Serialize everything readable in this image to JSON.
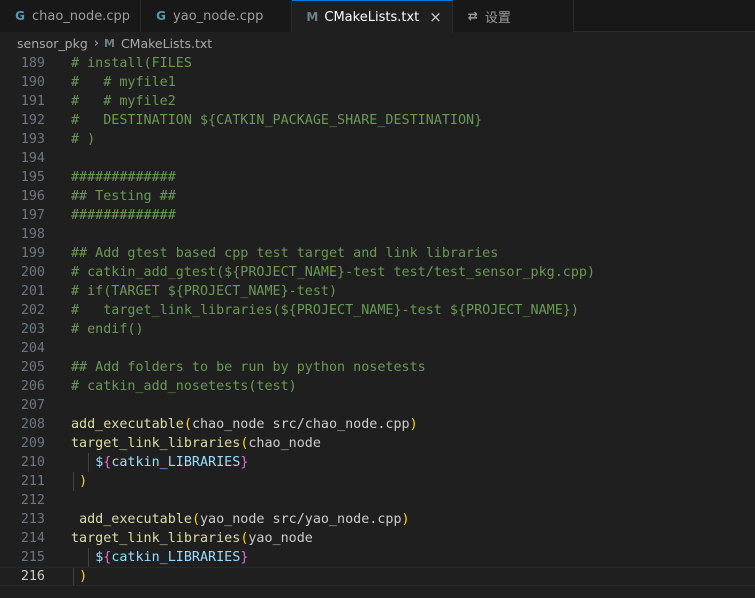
{
  "tabs": [
    {
      "label": "chao_node.cpp",
      "icon": "cpp-file-icon",
      "glyph": "G"
    },
    {
      "label": "yao_node.cpp",
      "icon": "cpp-file-icon",
      "glyph": "G"
    },
    {
      "label": "CMakeLists.txt",
      "icon": "cmake-file-icon",
      "glyph": "M",
      "active": true,
      "close": "×"
    },
    {
      "label": "设置",
      "icon": "settings-icon",
      "glyph": "⇄"
    }
  ],
  "breadcrumb": {
    "folder": "sensor_pkg",
    "separator": "›",
    "file_glyph": "M",
    "file": "CMakeLists.txt"
  },
  "editor": {
    "current_line": 216,
    "lines": [
      {
        "n": "189",
        "text": "# install(FILES"
      },
      {
        "n": "190",
        "text": "#   # myfile1"
      },
      {
        "n": "191",
        "text": "#   # myfile2"
      },
      {
        "n": "192",
        "text": "#   DESTINATION ${CATKIN_PACKAGE_SHARE_DESTINATION}"
      },
      {
        "n": "193",
        "text": "# )"
      },
      {
        "n": "194",
        "text": ""
      },
      {
        "n": "195",
        "text": "#############"
      },
      {
        "n": "196",
        "text": "## Testing ##"
      },
      {
        "n": "197",
        "text": "#############"
      },
      {
        "n": "198",
        "text": ""
      },
      {
        "n": "199",
        "text": "## Add gtest based cpp test target and link libraries"
      },
      {
        "n": "200",
        "text": "# catkin_add_gtest(${PROJECT_NAME}-test test/test_sensor_pkg.cpp)"
      },
      {
        "n": "201",
        "text": "# if(TARGET ${PROJECT_NAME}-test)"
      },
      {
        "n": "202",
        "text": "#   target_link_libraries(${PROJECT_NAME}-test ${PROJECT_NAME})"
      },
      {
        "n": "203",
        "text": "# endif()"
      },
      {
        "n": "204",
        "text": ""
      },
      {
        "n": "205",
        "text": "## Add folders to be run by python nosetests"
      },
      {
        "n": "206",
        "text": "# catkin_add_nosetests(test)"
      },
      {
        "n": "207",
        "text": ""
      },
      {
        "n": "208",
        "fn": "add_executable",
        "args": "chao_node src/chao_node.cpp"
      },
      {
        "n": "209",
        "fn": "target_link_libraries",
        "args": "chao_node"
      },
      {
        "n": "210",
        "var": "catkin_LIBRARIES"
      },
      {
        "n": "211",
        "close": ")"
      },
      {
        "n": "212",
        "text": ""
      },
      {
        "n": "213",
        "fn": "add_executable",
        "args": "yao_node src/yao_node.cpp",
        "lead": " "
      },
      {
        "n": "214",
        "fn": "target_link_libraries",
        "args": "yao_node"
      },
      {
        "n": "215",
        "var": "catkin_LIBRARIES"
      },
      {
        "n": "216",
        "close": ")"
      }
    ]
  },
  "colors": {
    "comment": "#6a9955",
    "function": "#dcdcaa",
    "bracket_level1": "#ffd700",
    "bracket_level2": "#da70d6",
    "variable": "#9cdcfe",
    "active_tab_border": "#0078d4"
  }
}
